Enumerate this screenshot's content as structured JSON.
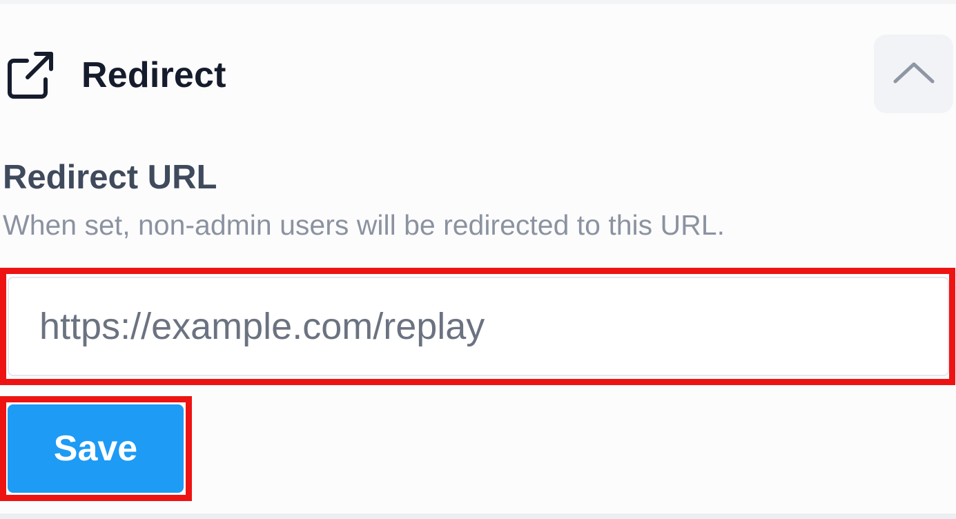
{
  "section": {
    "title": "Redirect",
    "icon": "external-link-icon",
    "collapse_icon": "chevron-up-icon"
  },
  "field": {
    "label": "Redirect URL",
    "help": "When set, non-admin users will be redirected to this URL.",
    "value": "",
    "placeholder": "https://example.com/replay"
  },
  "actions": {
    "save_label": "Save"
  },
  "colors": {
    "accent": "#1d9bf5",
    "highlight": "#ee1313",
    "title_text": "#151c2c",
    "help_text": "#8b92a0"
  }
}
